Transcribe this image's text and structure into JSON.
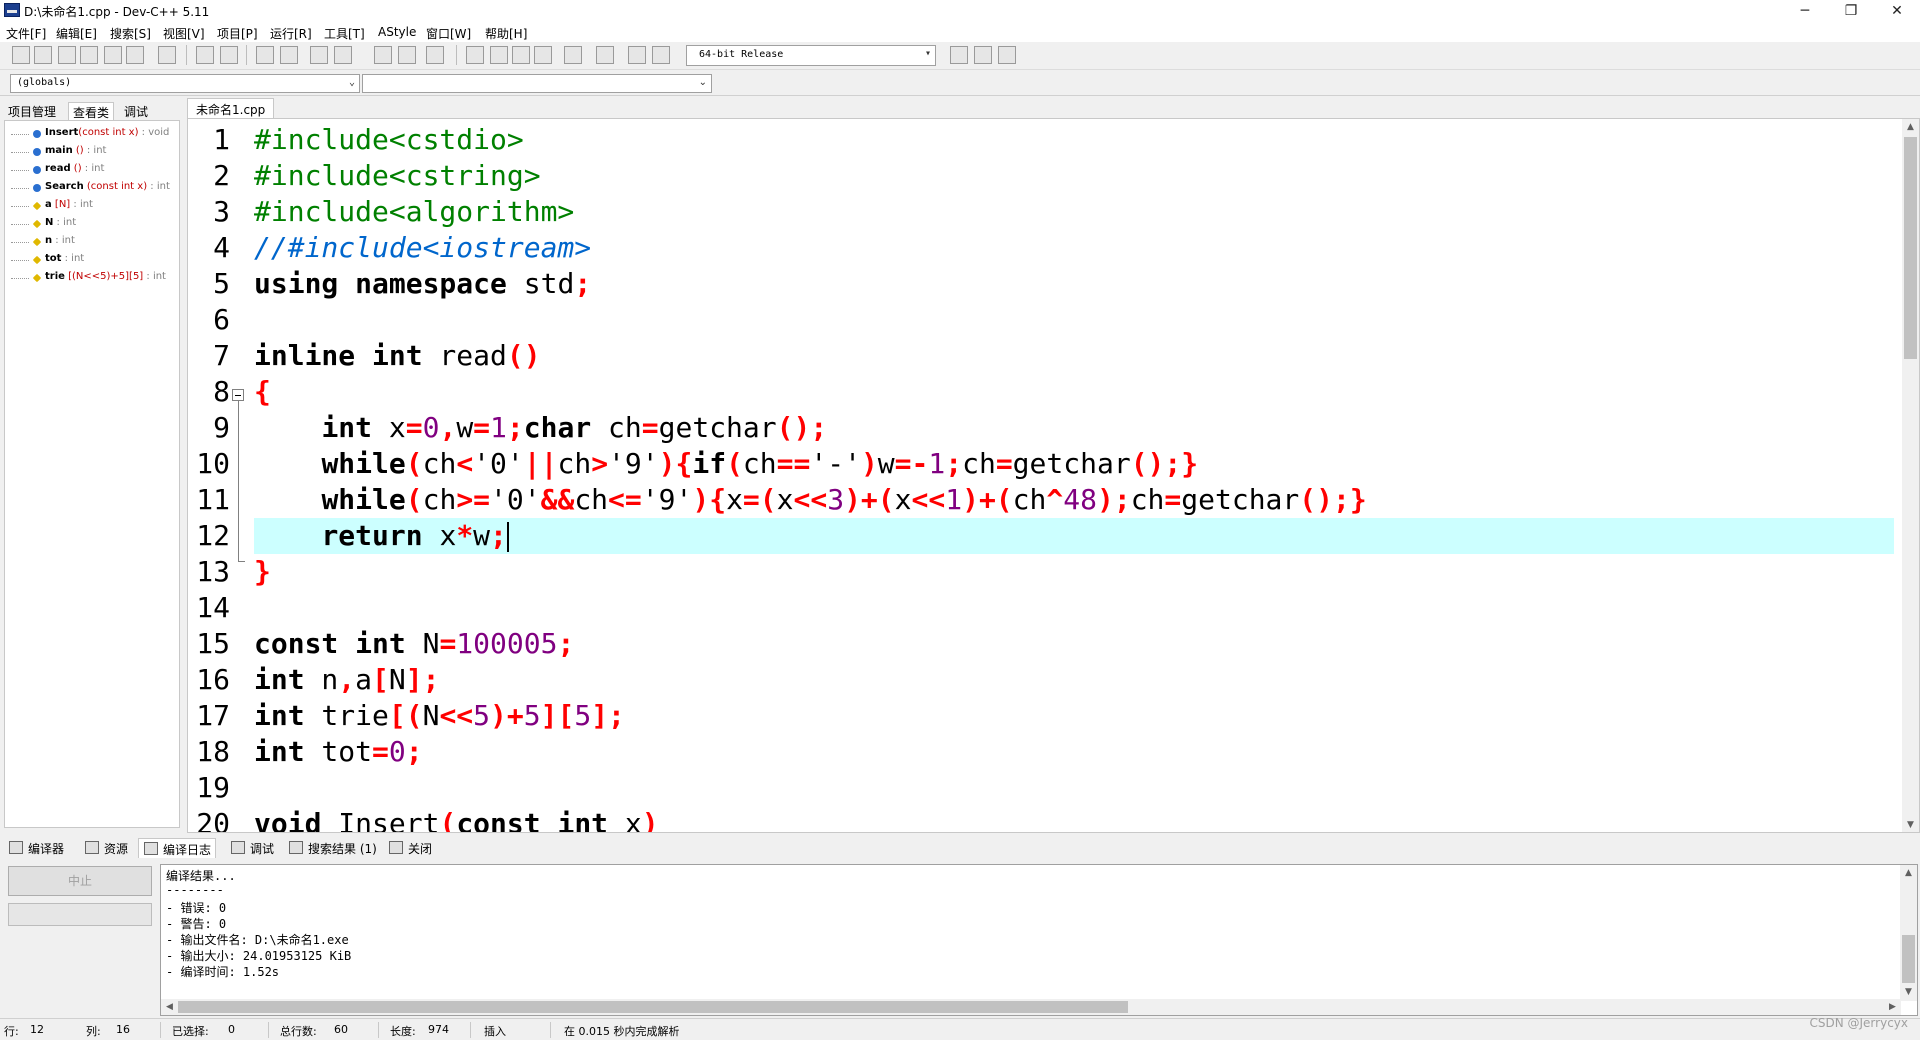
{
  "window": {
    "title": "D:\\未命名1.cpp - Dev-C++ 5.11",
    "controls": {
      "minimize": "─",
      "maximize": "❐",
      "close": "✕"
    }
  },
  "menu": [
    "文件[F]",
    "编辑[E]",
    "搜索[S]",
    "视图[V]",
    "项目[P]",
    "运行[R]",
    "工具[T]",
    "AStyle",
    "窗口[W]",
    "帮助[H]"
  ],
  "toolbar": {
    "build_config": "64-bit Release"
  },
  "classbar": {
    "scope": "(globals)",
    "member": ""
  },
  "left_panel": {
    "tabs": [
      "项目管理",
      "查看类",
      "调试"
    ],
    "active_tab": 1,
    "items": [
      {
        "name": "Insert",
        "args": "(const int x)",
        "type": " : void",
        "kind": "function"
      },
      {
        "name": "main",
        "args": " ()",
        "type": " : int",
        "kind": "function"
      },
      {
        "name": "read",
        "args": " ()",
        "type": " : int",
        "kind": "function"
      },
      {
        "name": "Search",
        "args": " (const int x)",
        "type": " : int",
        "kind": "function"
      },
      {
        "name": "a",
        "args": " [N]",
        "type": " : int",
        "kind": "variable"
      },
      {
        "name": "N",
        "args": "",
        "type": " : int",
        "kind": "variable"
      },
      {
        "name": "n",
        "args": "",
        "type": " : int",
        "kind": "variable"
      },
      {
        "name": "tot",
        "args": "",
        "type": " : int",
        "kind": "variable"
      },
      {
        "name": "trie",
        "args": " [(N<<5)+5][5]",
        "type": " : int",
        "kind": "variable"
      }
    ]
  },
  "editor": {
    "file_tab": "未命名1.cpp",
    "current_line": 12,
    "lines": [
      [
        [
          "pp",
          "#include<cstdio>"
        ]
      ],
      [
        [
          "pp",
          "#include<cstring>"
        ]
      ],
      [
        [
          "pp",
          "#include<algorithm>"
        ]
      ],
      [
        [
          "cm",
          "//#include<iostream>"
        ]
      ],
      [
        [
          "kw",
          "using namespace"
        ],
        [
          "str",
          " std"
        ],
        [
          "sym",
          ";"
        ]
      ],
      [],
      [
        [
          "kw",
          "inline int"
        ],
        [
          "str",
          " read"
        ],
        [
          "sym",
          "()"
        ]
      ],
      [
        [
          "sym",
          "{"
        ]
      ],
      [
        [
          "str",
          "    "
        ],
        [
          "kw",
          "int"
        ],
        [
          "str",
          " x"
        ],
        [
          "sym",
          "="
        ],
        [
          "num",
          "0"
        ],
        [
          "sym",
          ","
        ],
        [
          "str",
          "w"
        ],
        [
          "sym",
          "="
        ],
        [
          "num",
          "1"
        ],
        [
          "sym",
          ";"
        ],
        [
          "kw",
          "char"
        ],
        [
          "str",
          " ch"
        ],
        [
          "sym",
          "="
        ],
        [
          "str",
          "getchar"
        ],
        [
          "sym",
          "();"
        ]
      ],
      [
        [
          "str",
          "    "
        ],
        [
          "kw",
          "while"
        ],
        [
          "sym",
          "("
        ],
        [
          "str",
          "ch"
        ],
        [
          "sym",
          "<"
        ],
        [
          "str",
          "'0'"
        ],
        [
          "sym",
          "||"
        ],
        [
          "str",
          "ch"
        ],
        [
          "sym",
          ">"
        ],
        [
          "str",
          "'9'"
        ],
        [
          "sym",
          "){"
        ],
        [
          "kw",
          "if"
        ],
        [
          "sym",
          "("
        ],
        [
          "str",
          "ch"
        ],
        [
          "sym",
          "=="
        ],
        [
          "str",
          "'-'"
        ],
        [
          "sym",
          ")"
        ],
        [
          "str",
          "w"
        ],
        [
          "sym",
          "=-"
        ],
        [
          "num",
          "1"
        ],
        [
          "sym",
          ";"
        ],
        [
          "str",
          "ch"
        ],
        [
          "sym",
          "="
        ],
        [
          "str",
          "getchar"
        ],
        [
          "sym",
          "();}"
        ]
      ],
      [
        [
          "str",
          "    "
        ],
        [
          "kw",
          "while"
        ],
        [
          "sym",
          "("
        ],
        [
          "str",
          "ch"
        ],
        [
          "sym",
          ">="
        ],
        [
          "str",
          "'0'"
        ],
        [
          "sym",
          "&&"
        ],
        [
          "str",
          "ch"
        ],
        [
          "sym",
          "<="
        ],
        [
          "str",
          "'9'"
        ],
        [
          "sym",
          "){"
        ],
        [
          "str",
          "x"
        ],
        [
          "sym",
          "=("
        ],
        [
          "str",
          "x"
        ],
        [
          "sym",
          "<<"
        ],
        [
          "num",
          "3"
        ],
        [
          "sym",
          ")+("
        ],
        [
          "str",
          "x"
        ],
        [
          "sym",
          "<<"
        ],
        [
          "num",
          "1"
        ],
        [
          "sym",
          ")+("
        ],
        [
          "str",
          "ch"
        ],
        [
          "sym",
          "^"
        ],
        [
          "num",
          "48"
        ],
        [
          "sym",
          ");"
        ],
        [
          "str",
          "ch"
        ],
        [
          "sym",
          "="
        ],
        [
          "str",
          "getchar"
        ],
        [
          "sym",
          "();}"
        ]
      ],
      [
        [
          "str",
          "    "
        ],
        [
          "kw",
          "return"
        ],
        [
          "str",
          " x"
        ],
        [
          "sym",
          "*"
        ],
        [
          "str",
          "w"
        ],
        [
          "sym",
          ";"
        ]
      ],
      [
        [
          "sym",
          "}"
        ]
      ],
      [],
      [
        [
          "kw",
          "const int"
        ],
        [
          "str",
          " N"
        ],
        [
          "sym",
          "="
        ],
        [
          "num",
          "100005"
        ],
        [
          "sym",
          ";"
        ]
      ],
      [
        [
          "kw",
          "int"
        ],
        [
          "str",
          " n"
        ],
        [
          "sym",
          ","
        ],
        [
          "str",
          "a"
        ],
        [
          "sym",
          "["
        ],
        [
          "str",
          "N"
        ],
        [
          "sym",
          "];"
        ]
      ],
      [
        [
          "kw",
          "int"
        ],
        [
          "str",
          " trie"
        ],
        [
          "sym",
          "[("
        ],
        [
          "str",
          "N"
        ],
        [
          "sym",
          "<<"
        ],
        [
          "num",
          "5"
        ],
        [
          "sym",
          ")+"
        ],
        [
          "num",
          "5"
        ],
        [
          "sym",
          "]["
        ],
        [
          "num",
          "5"
        ],
        [
          "sym",
          "];"
        ]
      ],
      [
        [
          "kw",
          "int"
        ],
        [
          "str",
          " tot"
        ],
        [
          "sym",
          "="
        ],
        [
          "num",
          "0"
        ],
        [
          "sym",
          ";"
        ]
      ],
      [],
      [
        [
          "kw",
          "void"
        ],
        [
          "str",
          " Insert"
        ],
        [
          "sym",
          "("
        ],
        [
          "kw",
          "const int"
        ],
        [
          "str",
          " x"
        ],
        [
          "sym",
          ")"
        ]
      ]
    ]
  },
  "bottom_tabs": [
    {
      "label": "编译器",
      "icon": "grid-icon"
    },
    {
      "label": "资源",
      "icon": "resource-icon"
    },
    {
      "label": "编译日志",
      "icon": "chart-icon"
    },
    {
      "label": "调试",
      "icon": "check-icon"
    },
    {
      "label": "搜索结果 (1)",
      "icon": "search-results-icon"
    },
    {
      "label": "关闭",
      "icon": "close-panel-icon"
    }
  ],
  "compile": {
    "abort_label": "中止",
    "log": [
      "编译结果...",
      "--------",
      "- 错误: 0",
      "- 警告: 0",
      "- 输出文件名: D:\\未命名1.exe",
      "- 输出大小: 24.01953125 KiB",
      "- 编译时间: 1.52s"
    ]
  },
  "status": {
    "row_label": "行:",
    "row": "12",
    "col_label": "列:",
    "col": "16",
    "sel_label": "已选择:",
    "sel": "0",
    "total_label": "总行数:",
    "total": "60",
    "len_label": "长度:",
    "len": "974",
    "mode": "插入",
    "parse": "在 0.015 秒内完成解析"
  },
  "watermark": "CSDN @Jerrycyx"
}
